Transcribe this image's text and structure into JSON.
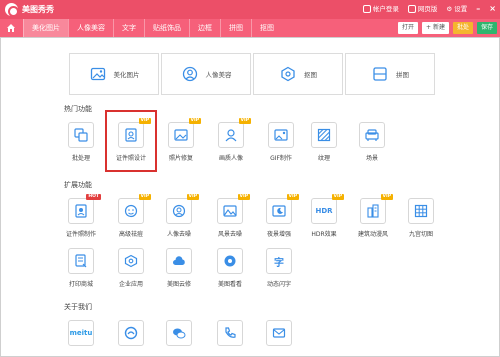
{
  "titlebar": {
    "app_title": "美图秀秀",
    "account": "帐户登录",
    "web_version": "网页版",
    "settings": "设置",
    "minimize": "–",
    "close": "×"
  },
  "tabs": [
    "美化图片",
    "人像美容",
    "文字",
    "贴纸饰品",
    "边框",
    "拼图",
    "抠图"
  ],
  "actions": {
    "open": "打开",
    "new": "+ 新建",
    "batch": "批处",
    "save": "保存"
  },
  "top_cards": [
    {
      "label": "美化图片",
      "icon": "image-edit-icon"
    },
    {
      "label": "人像美容",
      "icon": "portrait-icon"
    },
    {
      "label": "抠图",
      "icon": "cutout-icon"
    },
    {
      "label": "拼图",
      "icon": "collage-icon"
    }
  ],
  "sections": {
    "hot": "热门功能",
    "ext": "扩展功能",
    "about": "关于我们"
  },
  "hot_items": [
    {
      "label": "批处理",
      "icon": "batch-icon",
      "badge": ""
    },
    {
      "label": "证件照设计",
      "icon": "id-photo-icon",
      "badge": "VIP"
    },
    {
      "label": "照片修复",
      "icon": "photo-repair-icon",
      "badge": "VIP"
    },
    {
      "label": "画质人像",
      "icon": "portrait-quality-icon",
      "badge": "VIP"
    },
    {
      "label": "GIF制作",
      "icon": "gif-icon",
      "badge": ""
    },
    {
      "label": "纹理",
      "icon": "texture-icon",
      "badge": ""
    },
    {
      "label": "场景",
      "icon": "scene-icon",
      "badge": ""
    }
  ],
  "ext_items_row1": [
    {
      "label": "证件照制作",
      "icon": "id-photo-make-icon",
      "badge": "HOT"
    },
    {
      "label": "高级祛痘",
      "icon": "acne-remove-icon",
      "badge": "VIP"
    },
    {
      "label": "人像去噪",
      "icon": "portrait-denoise-icon",
      "badge": "VIP"
    },
    {
      "label": "风景去噪",
      "icon": "landscape-denoise-icon",
      "badge": "VIP"
    },
    {
      "label": "夜景增强",
      "icon": "night-enhance-icon",
      "badge": "VIP"
    },
    {
      "label": "HDR效果",
      "icon": "hdr-icon",
      "badge": "VIP"
    },
    {
      "label": "建筑动漫风",
      "icon": "building-anime-icon",
      "badge": "VIP"
    },
    {
      "label": "九宫切图",
      "icon": "grid-cut-icon",
      "badge": ""
    }
  ],
  "ext_items_row2": [
    {
      "label": "打印商城",
      "icon": "print-shop-icon",
      "badge": ""
    },
    {
      "label": "企业应用",
      "icon": "enterprise-app-icon",
      "badge": ""
    },
    {
      "label": "美图云修",
      "icon": "cloud-retouch-icon",
      "badge": ""
    },
    {
      "label": "美图看看",
      "icon": "meitu-viewer-icon",
      "badge": ""
    },
    {
      "label": "动态闪字",
      "icon": "flash-text-icon",
      "badge": ""
    }
  ],
  "about_items": [
    {
      "label": "meitu",
      "icon": "meitu-logo-icon"
    },
    {
      "label": "",
      "icon": "meitu-xiuxiu-icon"
    },
    {
      "label": "",
      "icon": "wechat-icon"
    },
    {
      "label": "",
      "icon": "phone-icon"
    },
    {
      "label": "",
      "icon": "mail-icon"
    }
  ],
  "colors": {
    "brand": "#ec4f68",
    "tabbar": "#f6607a",
    "vip": "#f5b100",
    "hot": "#e23e3e",
    "icon_blue": "#3a8ee6",
    "highlight": "#d9312f"
  }
}
